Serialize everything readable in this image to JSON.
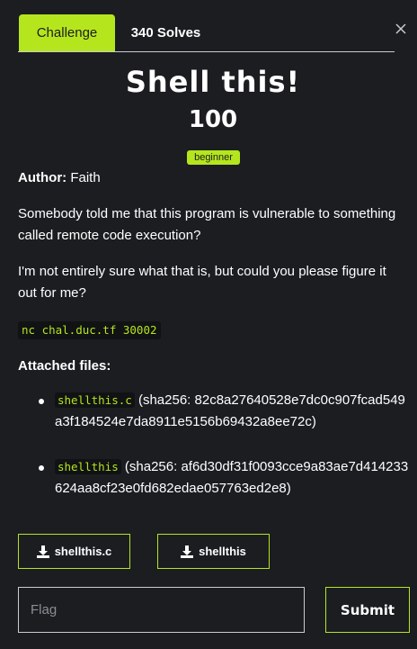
{
  "tabs": [
    {
      "label": "Challenge",
      "active": true
    },
    {
      "label": "340 Solves",
      "active": false
    }
  ],
  "close_icon": "close-icon",
  "challenge": {
    "title": "Shell this!",
    "points": "100",
    "tag": "beginner",
    "author_label": "Author:",
    "author_name": "Faith",
    "description": [
      "Somebody told me that this program is vulnerable to something called remote code execution?",
      "I'm not entirely sure what that is, but could you please figure it out for me?"
    ],
    "connection": "nc chal.duc.tf 30002",
    "files_label": "Attached files:",
    "files": [
      {
        "name": "shellthis.c",
        "hash_text": "(sha256: 82c8a27640528e7dc0c907fcad549a3f184524e7da8911e5156b69432a8ee72c)"
      },
      {
        "name": "shellthis",
        "hash_text": "(sha256: af6d30df31f0093cce9a83ae7d414233624aa8cf23e0fd682edae057763ed2e8)"
      }
    ]
  },
  "downloads": [
    {
      "label": "shellthis.c",
      "icon": "download-icon"
    },
    {
      "label": "shellthis",
      "icon": "download-icon"
    }
  ],
  "flag_input": {
    "placeholder": "Flag",
    "value": ""
  },
  "submit_label": "Submit",
  "colors": {
    "accent": "#b5e61d",
    "background": "#1b1d21"
  }
}
